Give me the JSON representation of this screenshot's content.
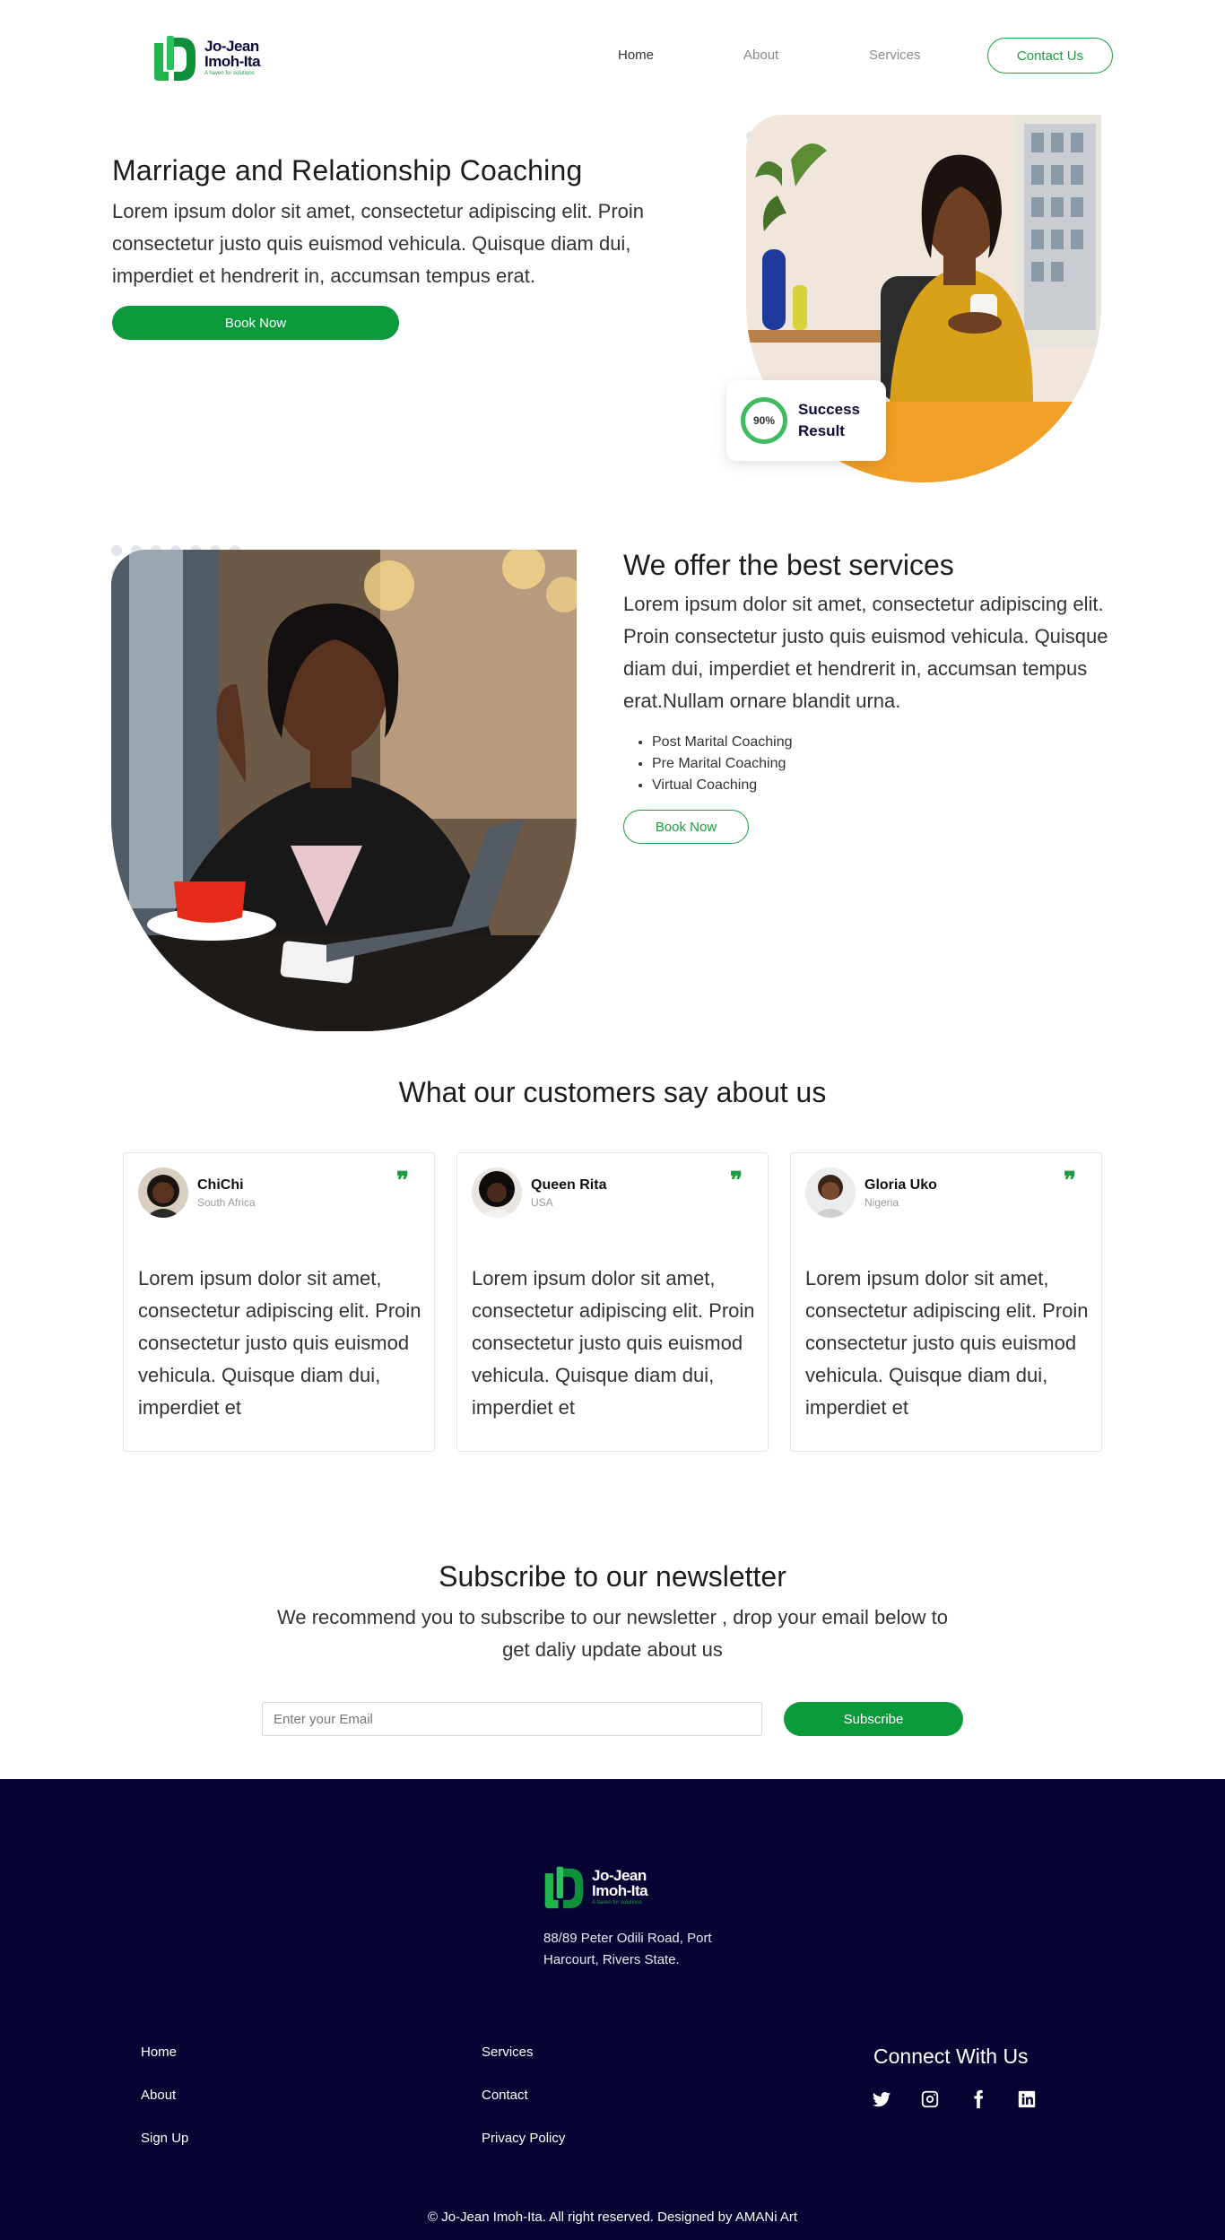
{
  "header": {
    "logo": {
      "name_line1": "Jo-Jean",
      "name_line2": "Imoh-Ita",
      "tagline": "A haven for solutions"
    },
    "nav": [
      {
        "label": "Home"
      },
      {
        "label": "About"
      },
      {
        "label": "Services"
      }
    ],
    "contact_button": "Contact Us"
  },
  "hero": {
    "title": "Marriage and Relationship Coaching",
    "text": "Lorem ipsum dolor sit amet, consectetur adipiscing elit. Proin consectetur justo quis euismod vehicula. Quisque diam dui, imperdiet et hendrerit in, accumsan tempus erat.",
    "button": "Book Now",
    "badge": {
      "percent": "90%",
      "label": "Success Result",
      "progress": 0.9
    }
  },
  "services": {
    "title": "We offer the best services",
    "text": "Lorem ipsum dolor sit amet, consectetur adipiscing elit. Proin consectetur justo quis euismod vehicula. Quisque diam dui, imperdiet et hendrerit in, accumsan tempus erat.Nullam ornare blandit urna.",
    "items": [
      "Post Marital Coaching",
      "Pre Marital Coaching",
      "Virtual Coaching"
    ],
    "button": "Book Now"
  },
  "testimonials": {
    "title": "What our customers say about us",
    "cards": [
      {
        "name": "ChiChi",
        "country": "South Africa",
        "text": "Lorem ipsum dolor sit amet, consectetur adipiscing elit. Proin consectetur justo quis euismod vehicula. Quisque diam dui, imperdiet et"
      },
      {
        "name": "Queen Rita",
        "country": "USA",
        "text": "Lorem ipsum dolor sit amet, consectetur adipiscing elit. Proin consectetur justo quis euismod vehicula. Quisque diam dui, imperdiet et"
      },
      {
        "name": "Gloria Uko",
        "country": "Nigeria",
        "text": "Lorem ipsum dolor sit amet, consectetur adipiscing elit. Proin consectetur justo quis euismod vehicula. Quisque diam dui, imperdiet et"
      }
    ]
  },
  "newsletter": {
    "title": "Subscribe to our newsletter",
    "text": "We recommend you to subscribe to our newsletter , drop your email below to get daliy update about us",
    "placeholder": "Enter your Email",
    "button": "Subscribe"
  },
  "footer": {
    "address": "88/89 Peter Odili Road, Port Harcourt, Rivers State.",
    "links_col1": [
      "Home",
      "About",
      "Sign Up"
    ],
    "links_col2": [
      "Services",
      "Contact",
      "Privacy Policy"
    ],
    "connect_title": "Connect With Us",
    "social_icons": [
      "twitter-icon",
      "instagram-icon",
      "facebook-icon",
      "linkedin-icon"
    ],
    "copyright": "© Jo-Jean Imoh-Ita. All right reserved. Designed by AMANi Art"
  },
  "colors": {
    "brand_green": "#0b9a3b",
    "footer_navy": "#070434"
  }
}
